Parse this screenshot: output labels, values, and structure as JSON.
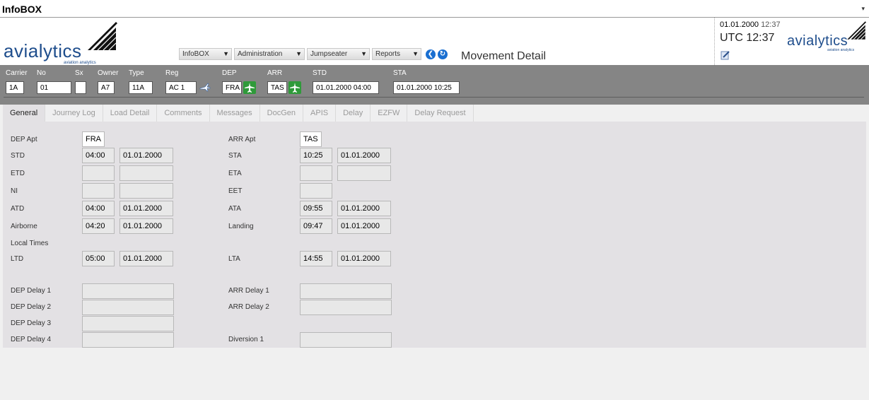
{
  "app": {
    "title": "InfoBOX",
    "caret": "▾"
  },
  "logo": {
    "word": "avialytics",
    "tagline": "aviation analytics"
  },
  "menus": [
    {
      "label": "InfoBOX"
    },
    {
      "label": "Administration"
    },
    {
      "label": "Jumpseater"
    },
    {
      "label": "Reports"
    }
  ],
  "nav": {
    "back": "❮",
    "refresh": "↻"
  },
  "page_title": "Movement Detail",
  "header_right": {
    "date": "01.01.2000",
    "time": "12:37",
    "utc": "UTC 12:37"
  },
  "flight": {
    "labels": {
      "carrier": "Carrier",
      "no": "No",
      "sx": "Sx",
      "owner": "Owner",
      "type": "Type",
      "reg": "Reg",
      "dep": "DEP",
      "arr": "ARR",
      "std": "STD",
      "sta": "STA"
    },
    "values": {
      "carrier": "1A",
      "no": "01",
      "sx": "",
      "owner": "A7",
      "type": "11A",
      "reg": "AC 1",
      "dep": "FRA",
      "arr": "TAS",
      "std": "01.01.2000 04:00",
      "sta": "01.01.2000 10:25"
    }
  },
  "tabs": [
    {
      "label": "General",
      "active": true
    },
    {
      "label": "Journey Log"
    },
    {
      "label": "Load Detail"
    },
    {
      "label": "Comments"
    },
    {
      "label": "Messages"
    },
    {
      "label": "DocGen"
    },
    {
      "label": "APIS"
    },
    {
      "label": "Delay"
    },
    {
      "label": "EZFW"
    },
    {
      "label": "Delay Request"
    }
  ],
  "general": {
    "left": {
      "dep_apt": {
        "label": "DEP Apt",
        "value": "FRA"
      },
      "std": {
        "label": "STD",
        "time": "04:00",
        "date": "01.01.2000"
      },
      "etd": {
        "label": "ETD",
        "time": "",
        "date": ""
      },
      "ni": {
        "label": "NI",
        "time": "",
        "date": ""
      },
      "atd": {
        "label": "ATD",
        "time": "04:00",
        "date": "01.01.2000"
      },
      "airborne": {
        "label": "Airborne",
        "time": "04:20",
        "date": "01.01.2000"
      },
      "local_times": {
        "label": "Local Times"
      },
      "ltd": {
        "label": "LTD",
        "time": "05:00",
        "date": "01.01.2000"
      },
      "dep_delay_1": {
        "label": "DEP Delay 1",
        "value": ""
      },
      "dep_delay_2": {
        "label": "DEP Delay 2",
        "value": ""
      },
      "dep_delay_3": {
        "label": "DEP Delay 3",
        "value": ""
      },
      "dep_delay_4": {
        "label": "DEP Delay 4",
        "value": ""
      }
    },
    "right": {
      "arr_apt": {
        "label": "ARR Apt",
        "value": "TAS"
      },
      "sta": {
        "label": "STA",
        "time": "10:25",
        "date": "01.01.2000"
      },
      "eta": {
        "label": "ETA",
        "time": "",
        "date": ""
      },
      "eet": {
        "label": "EET",
        "time": ""
      },
      "ata": {
        "label": "ATA",
        "time": "09:55",
        "date": "01.01.2000"
      },
      "landing": {
        "label": "Landing",
        "time": "09:47",
        "date": "01.01.2000"
      },
      "lta": {
        "label": "LTA",
        "time": "14:55",
        "date": "01.01.2000"
      },
      "arr_delay_1": {
        "label": "ARR Delay 1",
        "value": ""
      },
      "arr_delay_2": {
        "label": "ARR Delay 2",
        "value": ""
      },
      "diversion_1": {
        "label": "Diversion 1",
        "value": ""
      }
    }
  },
  "colors": {
    "brand": "#1e4d8c",
    "flightbar": "#858585",
    "panel": "#e3e1e4",
    "green_plane": "#2f9a3a",
    "nav_blue": "#1a6fd1"
  }
}
